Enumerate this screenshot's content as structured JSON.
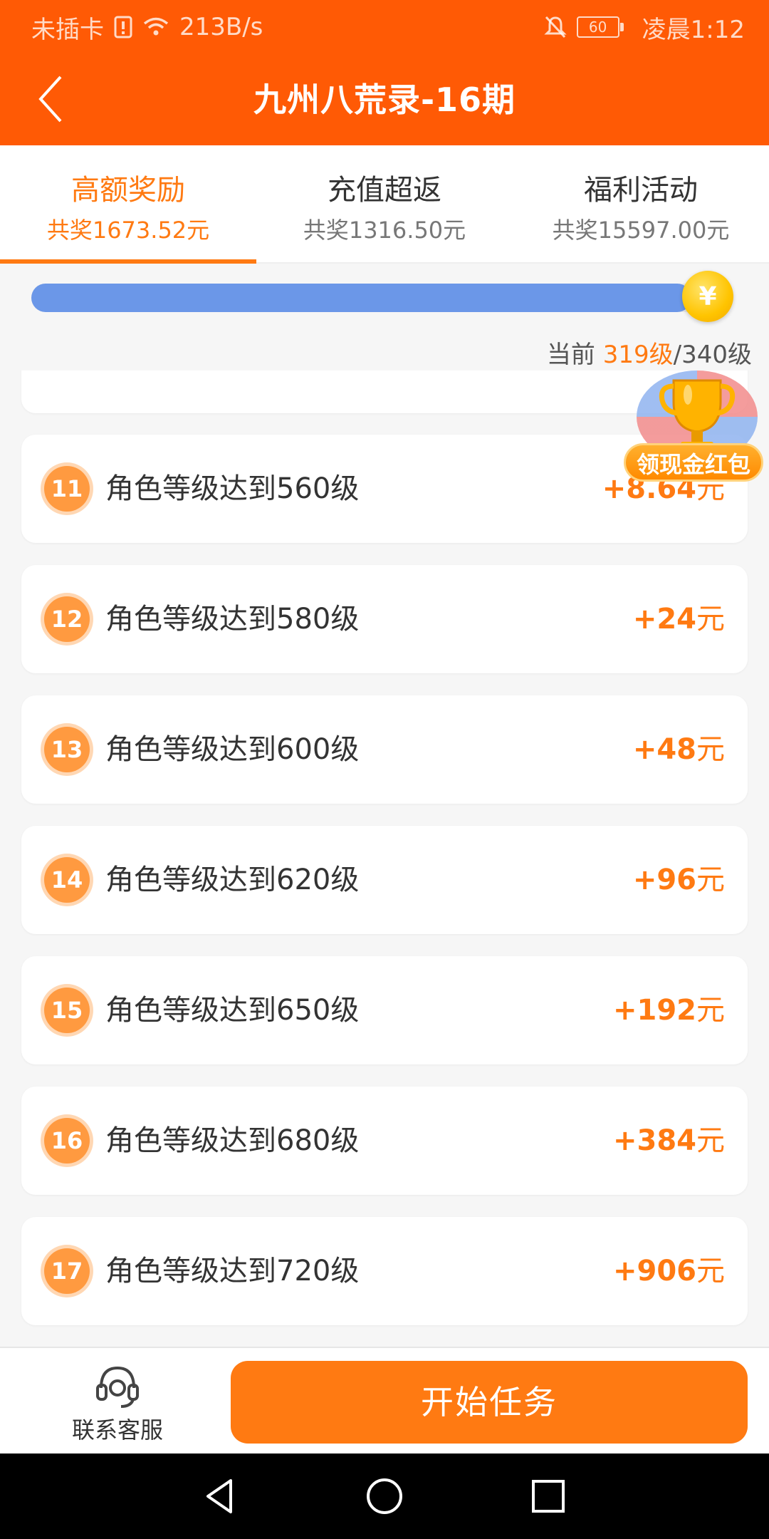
{
  "status_bar": {
    "carrier": "未插卡",
    "speed": "213B/s",
    "battery": "60",
    "time": "凌晨1:12"
  },
  "header": {
    "title": "九州八荒录-16期"
  },
  "tabs": [
    {
      "label": "高额奖励",
      "sub": "共奖1673.52元",
      "active": true
    },
    {
      "label": "充值超返",
      "sub": "共奖1316.50元",
      "active": false
    },
    {
      "label": "福利活动",
      "sub": "共奖15597.00元",
      "active": false
    }
  ],
  "progress": {
    "prefix": "当前 ",
    "current": "319级",
    "total": "/340级",
    "coin_symbol": "¥",
    "fill_fraction": 0.94
  },
  "red_packet": {
    "label": "领现金红包"
  },
  "tasks": [
    {
      "num": "11",
      "label": "角色等级达到560级",
      "amount": "+8.64",
      "unit": "元"
    },
    {
      "num": "12",
      "label": "角色等级达到580级",
      "amount": "+24",
      "unit": "元"
    },
    {
      "num": "13",
      "label": "角色等级达到600级",
      "amount": "+48",
      "unit": "元"
    },
    {
      "num": "14",
      "label": "角色等级达到620级",
      "amount": "+96",
      "unit": "元"
    },
    {
      "num": "15",
      "label": "角色等级达到650级",
      "amount": "+192",
      "unit": "元"
    },
    {
      "num": "16",
      "label": "角色等级达到680级",
      "amount": "+384",
      "unit": "元"
    },
    {
      "num": "17",
      "label": "角色等级达到720级",
      "amount": "+906",
      "unit": "元"
    }
  ],
  "bottom": {
    "support_label": "联系客服",
    "start_label": "开始任务"
  },
  "colors": {
    "brand": "#ff5a05",
    "accent": "#ff7a12",
    "progress": "#6b97e8"
  }
}
